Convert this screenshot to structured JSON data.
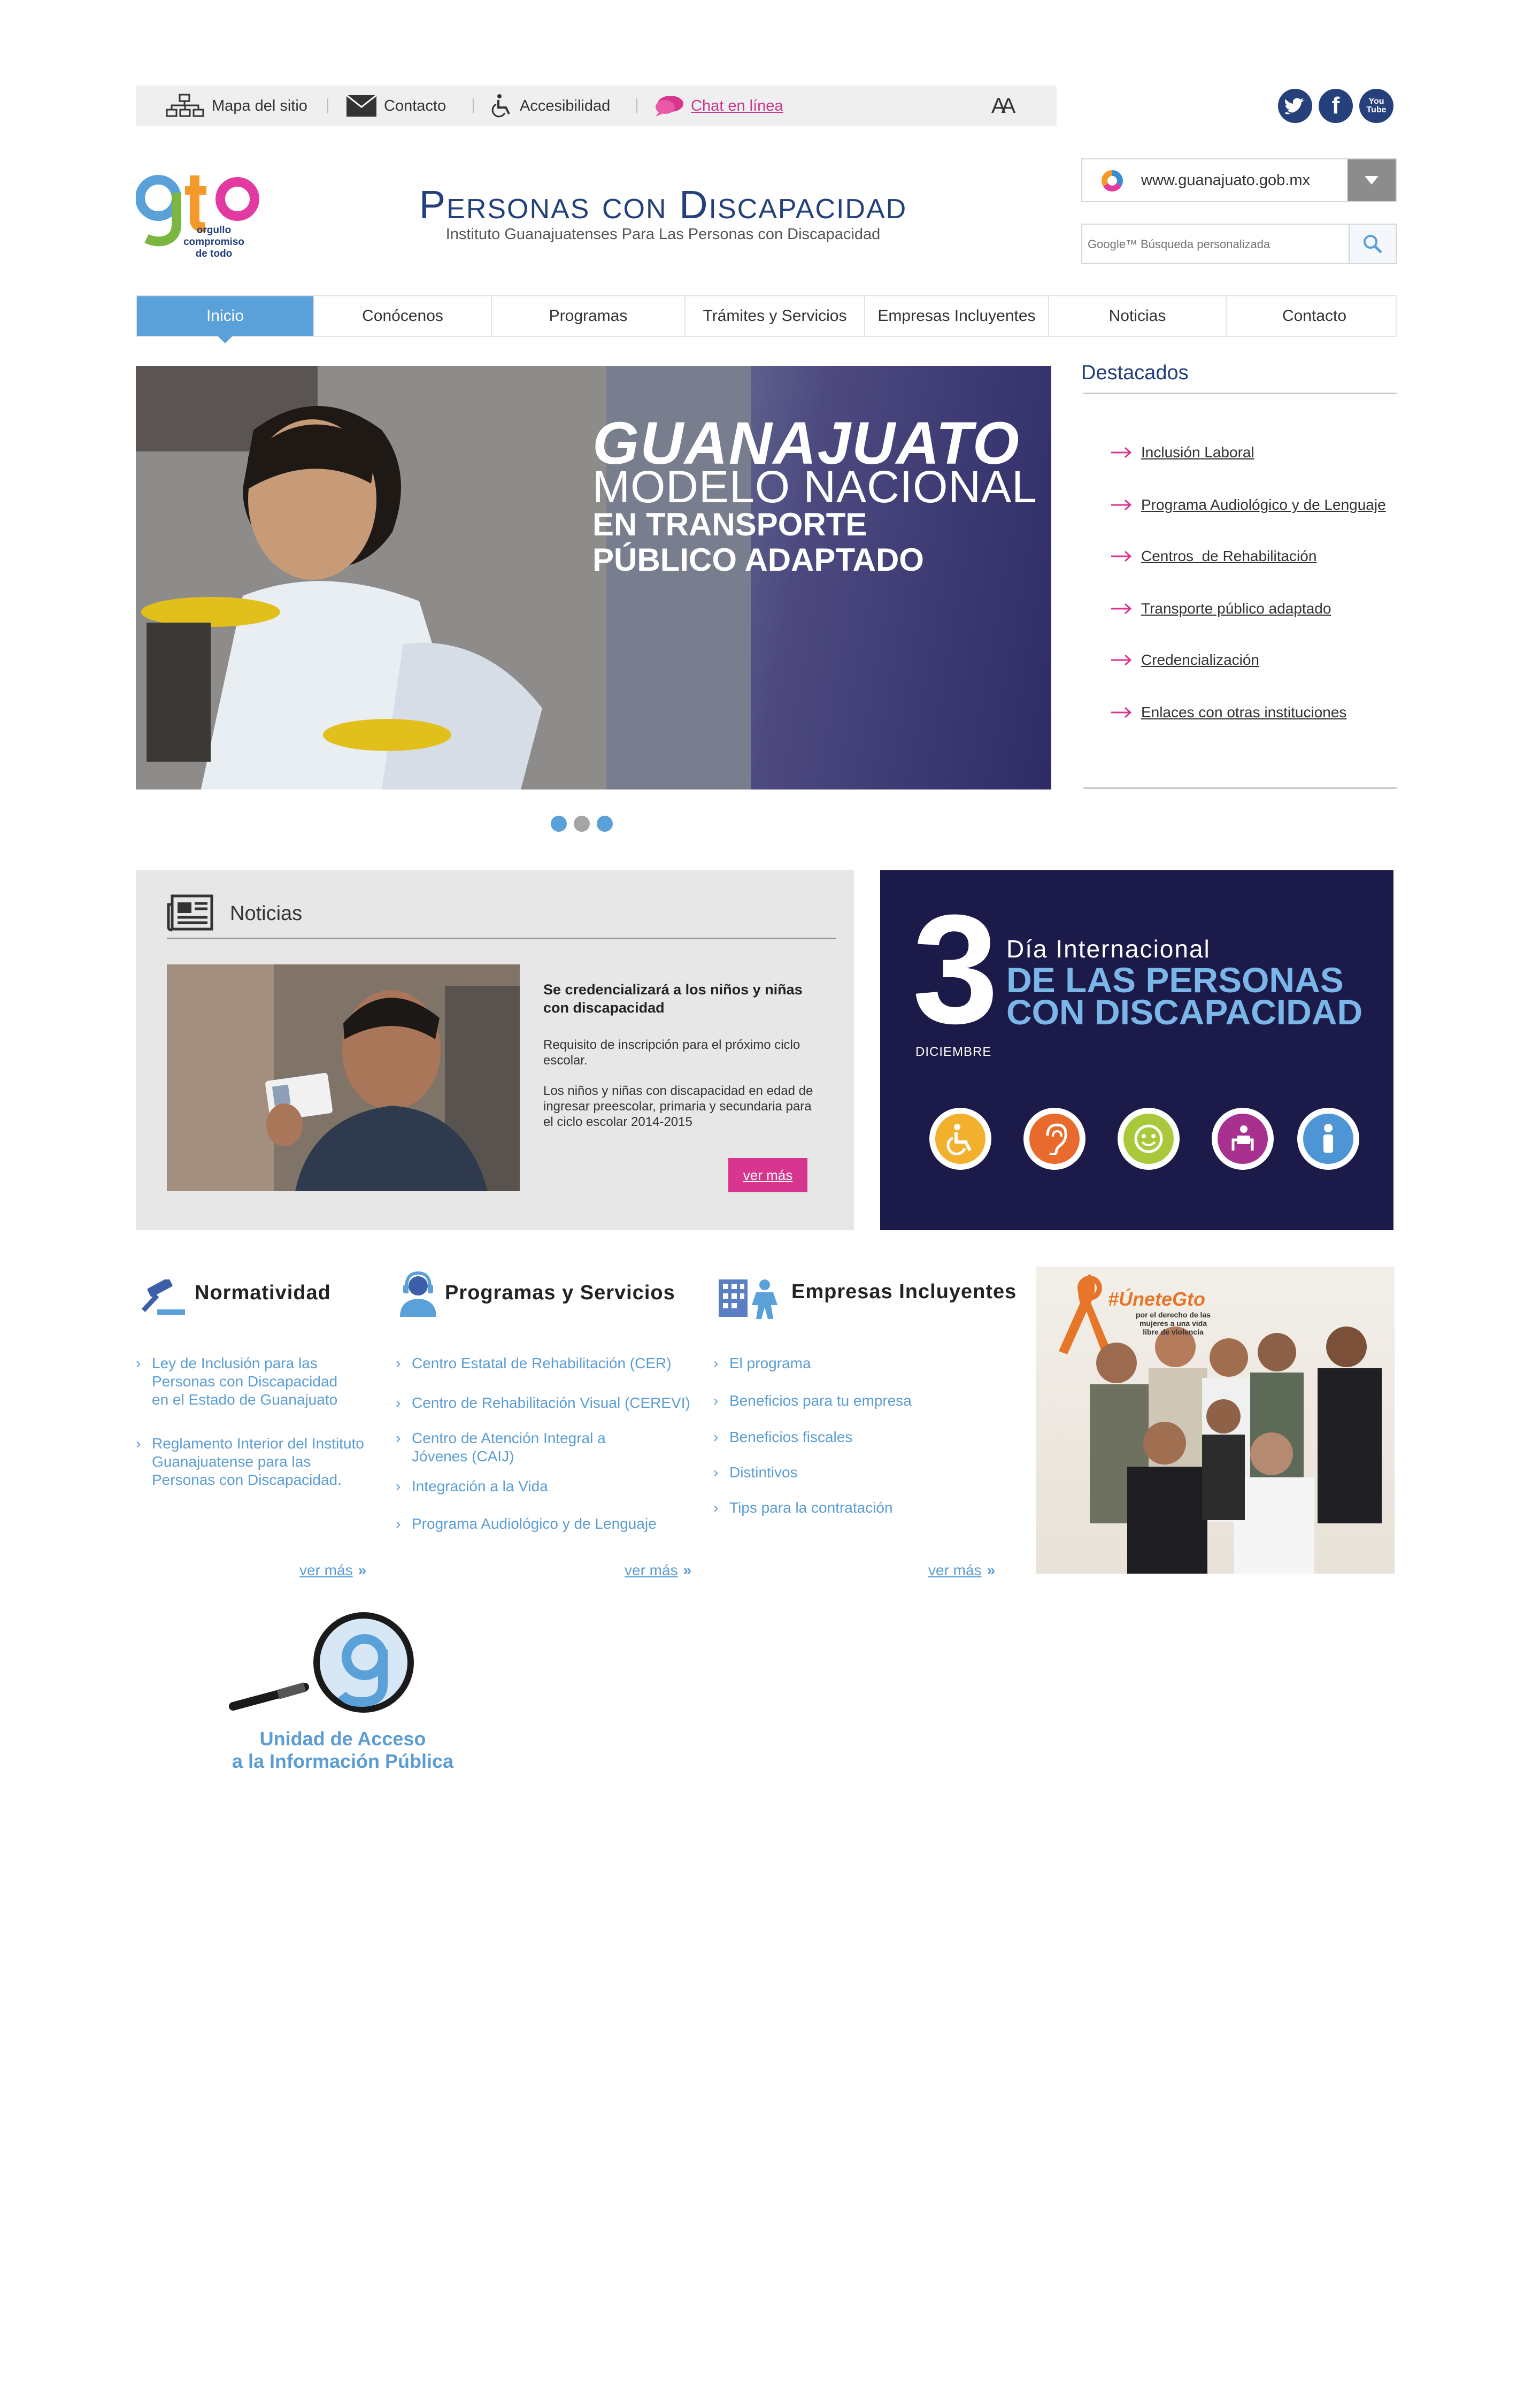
{
  "utility": {
    "site_map": "Mapa del sitio",
    "contact": "Contacto",
    "accessibility": "Accesibilidad",
    "chat": "Chat en línea",
    "font_size": "AA"
  },
  "social": {
    "twitter": "t",
    "facebook": "f",
    "youtube": "You Tube"
  },
  "header": {
    "logo_text": "gto",
    "logo_tagline_1": "orgullo",
    "logo_tagline_2": "compromiso",
    "logo_tagline_3": "de todo",
    "title": "Personas con Discapacidad",
    "subtitle": "Instituto Guanajuatenses Para Las Personas con Discapacidad",
    "portal": "www.guanajuato.gob.mx",
    "search_placeholder": "Google™ Búsqueda personalizada"
  },
  "nav": {
    "items": [
      "Inicio",
      "Conócenos",
      "Programas",
      "Trámites y Servicios",
      "Empresas Incluyentes",
      "Noticias",
      "Contacto"
    ],
    "active": "Inicio"
  },
  "hero": {
    "line1": "GUANAJUATO",
    "line2": "MODELO NACIONAL",
    "line3": "EN TRANSPORTE",
    "line4": "PÚBLICO ADAPTADO"
  },
  "destacados": {
    "title": "Destacados",
    "items": [
      "Inclusión Laboral",
      "Programa Audiológico y de Lenguaje",
      "Centros  de Rehabilitación",
      "Transporte público adaptado",
      "Credencialización",
      "Enlaces con otras instituciones"
    ]
  },
  "news": {
    "title": "Noticias",
    "headline": "Se credencializará a los niños y niñas con discapacidad",
    "p1": "Requisito de inscripción para el próximo ciclo escolar.",
    "p2": "Los niños y niñas con discapacidad en edad de ingresar preescolar, primaria y secundaria para el ciclo escolar 2014-2015",
    "more": "ver más"
  },
  "day_banner": {
    "number": "3",
    "month": "DICIEMBRE",
    "line1": "Día Internacional",
    "line2": "DE LAS PERSONAS",
    "line3": "CON DISCAPACIDAD",
    "icon_colors": [
      "#f2b02d",
      "#e86a2c",
      "#a9c93a",
      "#a8318f",
      "#4e95d6"
    ]
  },
  "normatividad": {
    "title": "Normatividad",
    "links": [
      "Ley de Inclusión para las Personas con Discapacidad en el Estado de Guanajuato",
      "Reglamento Interior del Instituto Guanajuatense para las Personas con Discapacidad."
    ],
    "more": "ver más"
  },
  "programas": {
    "title": "Programas y Servicios",
    "links": [
      "Centro Estatal de Rehabilitación (CER)",
      "Centro de Rehabilitación Visual (CEREVI)",
      "Centro de Atención Integral a Jóvenes (CAIJ)",
      "Integración a la Vida",
      "Programa Audiológico y de Lenguaje"
    ],
    "more": "ver más"
  },
  "empresas": {
    "title": "Empresas Incluyentes",
    "links": [
      "El programa",
      "Beneficios para tu empresa",
      "Beneficios fiscales",
      "Distintivos",
      "Tips para la contratación"
    ],
    "more": "ver más"
  },
  "campaign": {
    "hashtag": "#ÚneteGto",
    "line1": "por el derecho de las",
    "line2": "mujeres a una vida",
    "line3": "libre de violencia"
  },
  "acceso": {
    "line1": "Unidad de Acceso",
    "line2": "a la Información Pública"
  },
  "colors": {
    "brand_blue": "#24407b",
    "accent_blue": "#5aa0d9",
    "accent_pink": "#d8358f"
  }
}
